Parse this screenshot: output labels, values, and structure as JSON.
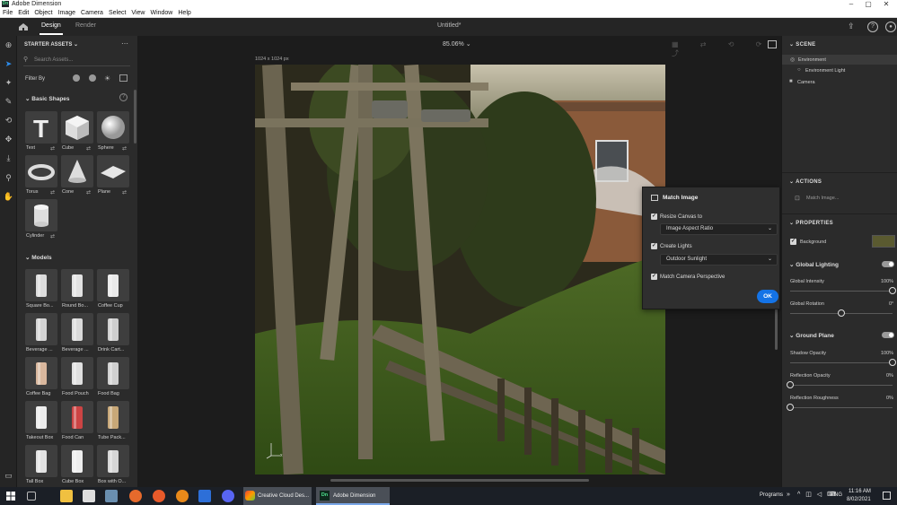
{
  "window": {
    "title": "Adobe Dimension",
    "app_badge": "Dn"
  },
  "menu": [
    "File",
    "Edit",
    "Object",
    "Image",
    "Camera",
    "Select",
    "View",
    "Window",
    "Help"
  ],
  "topbar": {
    "tabs": [
      "Design",
      "Render"
    ],
    "document_title": "Untitled*",
    "zoom": "85.06%"
  },
  "assets": {
    "header": "STARTER ASSETS",
    "search_placeholder": "Search Assets...",
    "filter_label": "Filter By",
    "basic_section": "Basic Shapes",
    "basic_shapes": [
      "Text",
      "Cube",
      "Sphere",
      "Torus",
      "Cone",
      "Plane",
      "Cylinder"
    ],
    "models_section": "Models",
    "models": [
      "Square Bo...",
      "Round Bo...",
      "Coffee Cup",
      "Beverage ...",
      "Beverage ...",
      "Drink Cart...",
      "Coffee Bag",
      "Food Pouch",
      "Food Bag",
      "Takeout Box",
      "Food Can",
      "Tube Pack...",
      "Tall Box",
      "Cube Box",
      "Box with O..."
    ]
  },
  "canvas": {
    "size_label": "1024 x 1024 px",
    "axis_x": "x"
  },
  "dialog": {
    "title": "Match Image",
    "resize_label": "Resize Canvas to",
    "resize_value": "Image Aspect Ratio",
    "lights_label": "Create Lights",
    "lights_value": "Outdoor Sunlight",
    "perspective_label": "Match Camera Perspective",
    "ok": "OK"
  },
  "scene": {
    "header": "SCENE",
    "items": [
      "Environment",
      "Environment Light",
      "Camera"
    ]
  },
  "actions": {
    "header": "ACTIONS",
    "match_image": "Match Image..."
  },
  "properties": {
    "header": "PROPERTIES",
    "background": "Background",
    "global_lighting": "Global Lighting",
    "global_intensity": {
      "label": "Global Intensity",
      "value": "100%",
      "fraction": 1.0
    },
    "global_rotation": {
      "label": "Global Rotation",
      "value": "0°",
      "fraction": 0.5
    },
    "ground_plane": "Ground Plane",
    "shadow_opacity": {
      "label": "Shadow Opacity",
      "value": "100%",
      "fraction": 1.0
    },
    "reflection_opacity": {
      "label": "Reflection Opacity",
      "value": "0%",
      "fraction": 0.0
    },
    "reflection_roughness": {
      "label": "Reflection Roughness",
      "value": "0%",
      "fraction": 0.0
    }
  },
  "taskbar": {
    "apps": [
      "Creative Cloud Des...",
      "Adobe Dimension"
    ],
    "programs": "Programs",
    "lang": "ENG",
    "time": "11:16 AM",
    "date": "8/02/2021"
  },
  "colors": {
    "accent": "#1473e6",
    "panel": "#2b2b2b",
    "canvas_bg": "#1c1c1c"
  }
}
